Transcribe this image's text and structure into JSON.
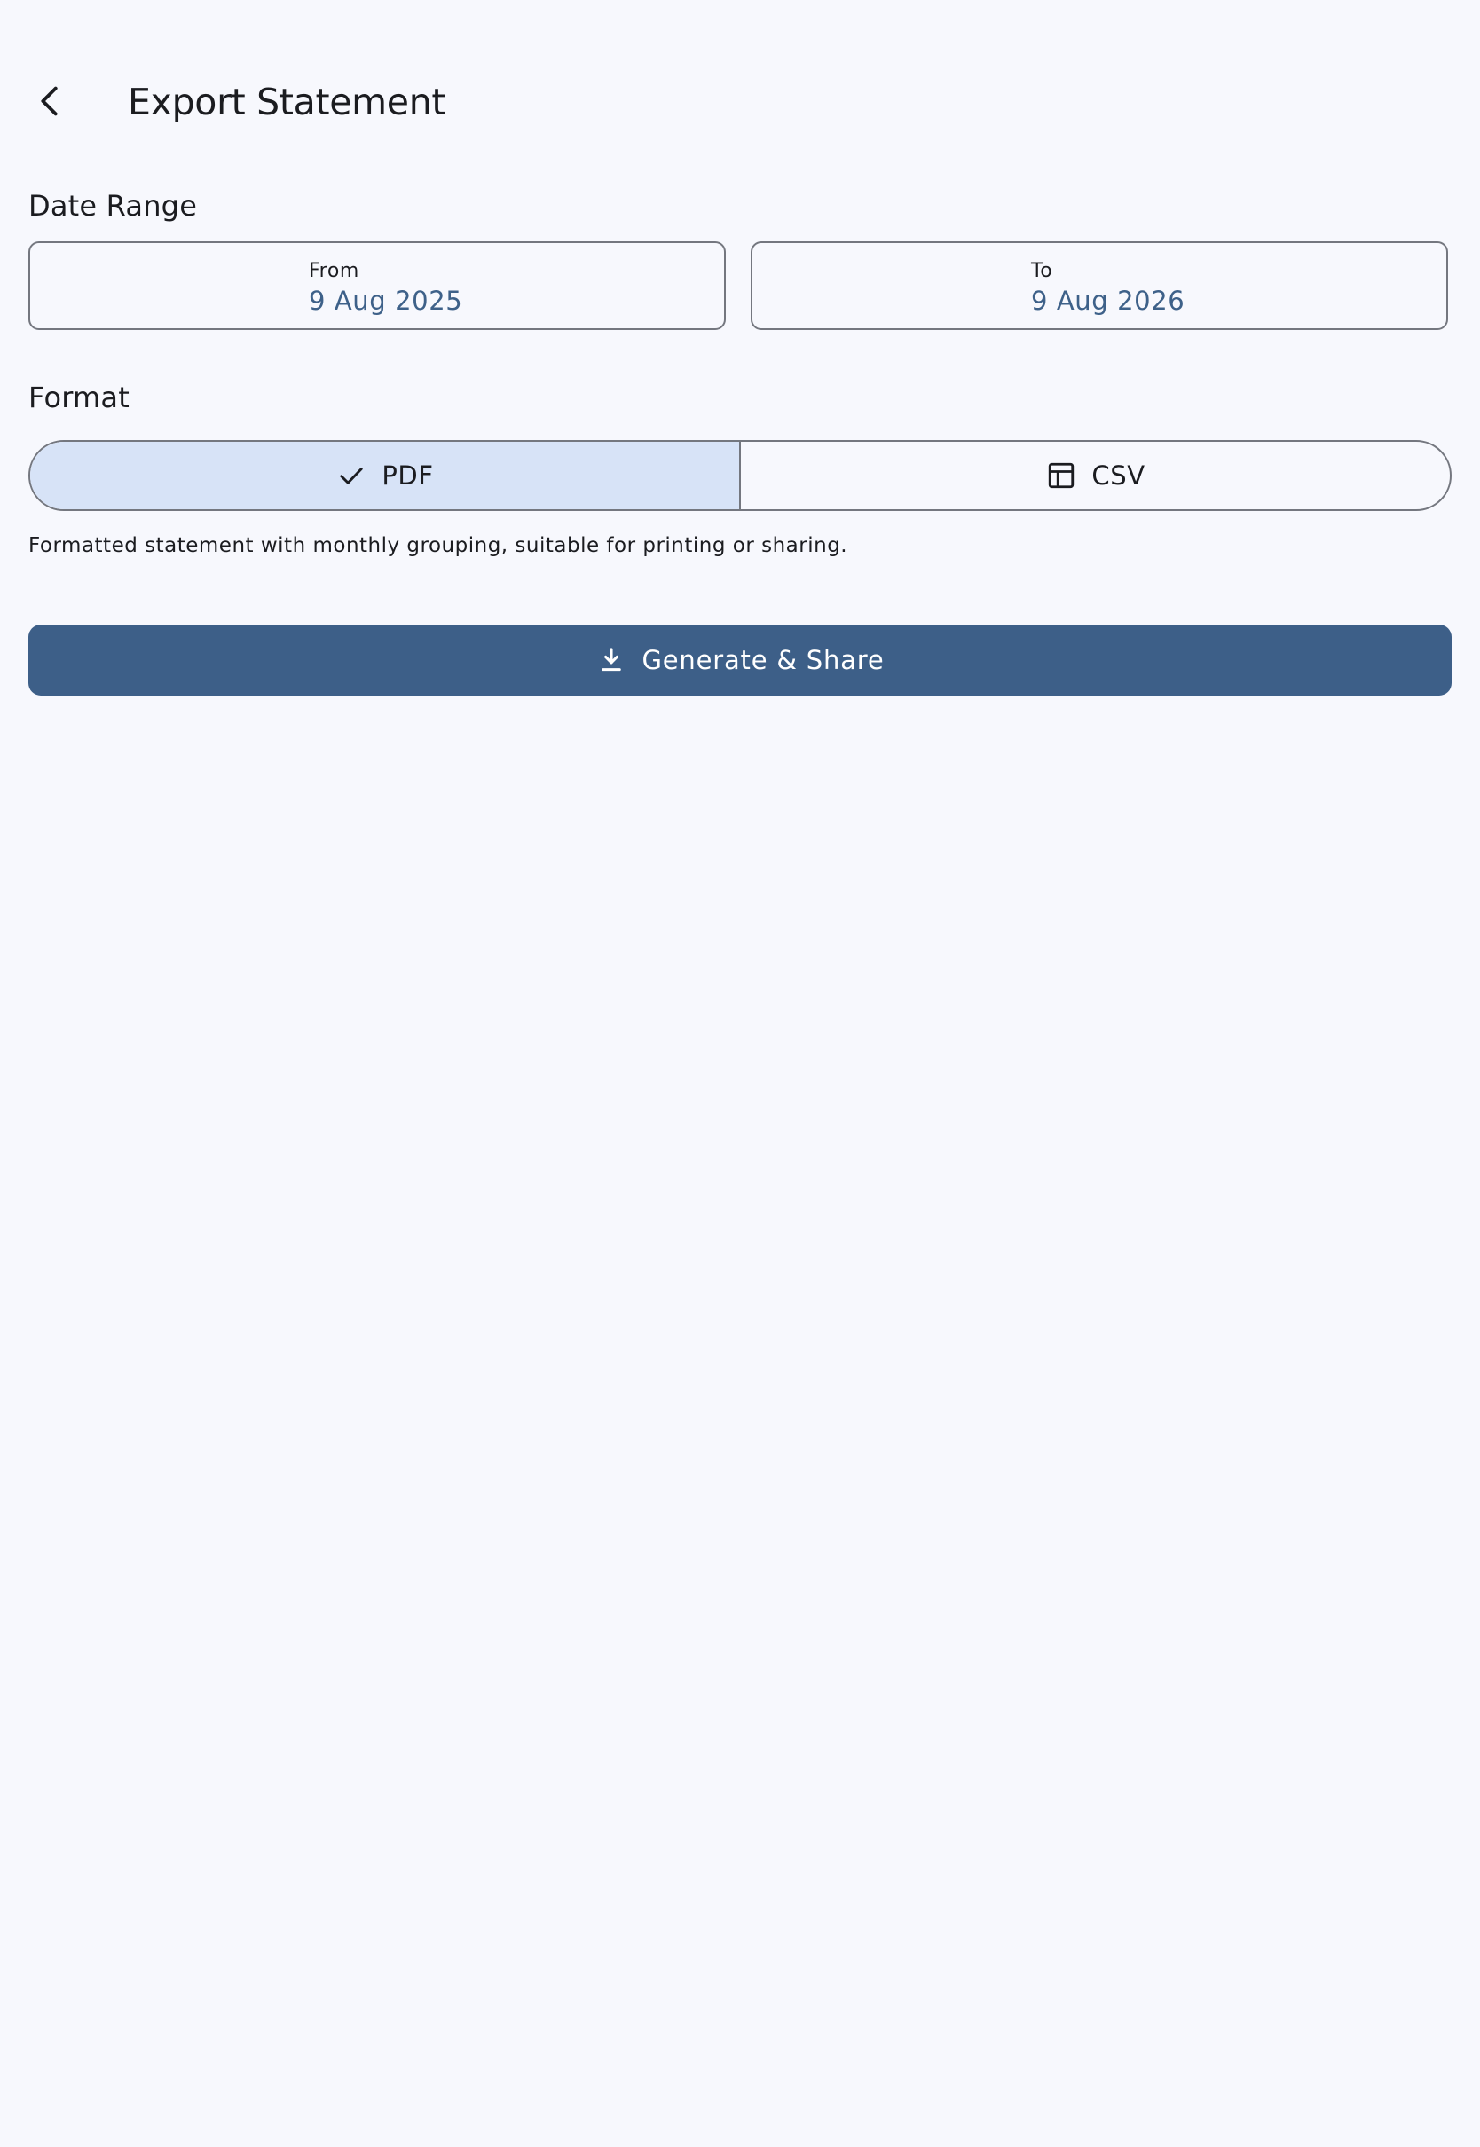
{
  "header": {
    "title": "Export Statement",
    "back_icon": "arrow-back-icon"
  },
  "date_range": {
    "label": "Date Range",
    "from": {
      "caption": "From",
      "value": "9 Aug 2025"
    },
    "to": {
      "caption": "To",
      "value": "9 Aug 2026"
    }
  },
  "format": {
    "label": "Format",
    "options": [
      {
        "label": "PDF",
        "icon": "check-icon",
        "selected": true
      },
      {
        "label": "CSV",
        "icon": "table-icon",
        "selected": false
      }
    ],
    "description": "Formatted statement with monthly grouping, suitable for printing or sharing."
  },
  "action": {
    "label": "Generate & Share",
    "icon": "download-icon"
  },
  "colors": {
    "background": "#f7f8fd",
    "primary": "#3d5f88",
    "selected_segment": "#d7e3f7",
    "date_value": "#3e6189",
    "outline": "#74777f"
  }
}
